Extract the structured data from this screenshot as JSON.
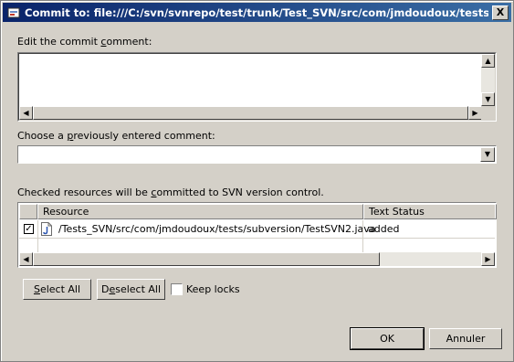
{
  "window": {
    "title": "Commit to: file:///C:/svn/svnrepo/test/trunk/Test_SVN/src/com/jmdoudoux/tests/sub...",
    "close_glyph": "X"
  },
  "comment": {
    "label_pre": "Edit the commit ",
    "label_access": "c",
    "label_post": "omment:",
    "value": ""
  },
  "previous": {
    "label_pre": "Choose a ",
    "label_access": "p",
    "label_post": "reviously entered comment:",
    "selected": ""
  },
  "resources": {
    "label_pre": "Checked resources will be ",
    "label_access": "c",
    "label_post": "ommitted to SVN version control.",
    "columns": [
      "Resource",
      "Text Status"
    ],
    "rows": [
      {
        "checked": true,
        "icon": "java-file-icon",
        "resource": "/Tests_SVN/src/com/jmdoudoux/tests/subversion/TestSVN2.java",
        "status": "added"
      }
    ]
  },
  "actions": {
    "select_all_access": "S",
    "select_all_rest": "elect All",
    "deselect_pre": "D",
    "deselect_access": "e",
    "deselect_rest": "select All",
    "keep_locks": "Keep locks",
    "keep_locks_checked": false
  },
  "footer": {
    "ok": "OK",
    "cancel": "Annuler"
  },
  "glyphs": {
    "up": "▲",
    "down": "▼",
    "left": "◀",
    "right": "▶",
    "check": "✓"
  }
}
